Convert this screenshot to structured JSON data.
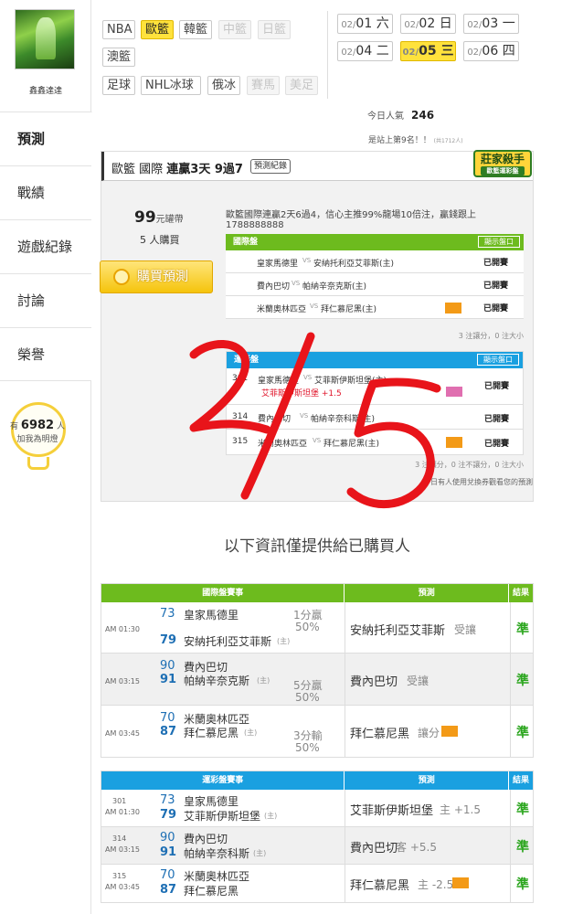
{
  "user": {
    "name": "鑫鑫達達"
  },
  "sidebar": {
    "items": [
      {
        "label": "預測",
        "active": true
      },
      {
        "label": "戰績"
      },
      {
        "label": "遊戲紀錄"
      },
      {
        "label": "討論"
      },
      {
        "label": "榮譽"
      }
    ],
    "fans_prefix": "有",
    "fans_count": "6982",
    "fans_suffix": "人",
    "fans_note": "加我為明燈"
  },
  "leagues": {
    "row1": [
      {
        "label": "NBA",
        "state": "normal"
      },
      {
        "label": "歐籃",
        "state": "selected"
      },
      {
        "label": "韓籃",
        "state": "normal"
      },
      {
        "label": "中籃",
        "state": "disabled"
      },
      {
        "label": "日籃",
        "state": "disabled"
      }
    ],
    "row2": [
      {
        "label": "澳籃",
        "state": "normal"
      }
    ],
    "row3": [
      {
        "label": "足球",
        "state": "normal"
      },
      {
        "label": "NHL冰球",
        "state": "normal"
      },
      {
        "label": "俄冰",
        "state": "normal"
      },
      {
        "label": "賽馬",
        "state": "disabled"
      },
      {
        "label": "美足",
        "state": "disabled"
      }
    ]
  },
  "dates": [
    {
      "mm": "02/",
      "dd": "01",
      "wd": "六",
      "selected": false
    },
    {
      "mm": "02/",
      "dd": "02",
      "wd": "日",
      "selected": false
    },
    {
      "mm": "02/",
      "dd": "03",
      "wd": "一",
      "selected": false
    },
    {
      "mm": "02/",
      "dd": "04",
      "wd": "二",
      "selected": false
    },
    {
      "mm": "02/",
      "dd": "05",
      "wd": "三",
      "selected": true
    },
    {
      "mm": "02/",
      "dd": "06",
      "wd": "四",
      "selected": false
    }
  ],
  "stats": {
    "popular_label": "今日人氣",
    "popular_value": "246",
    "rank_text": "是站上第9名！！",
    "rank_small": "(共1712人)"
  },
  "card": {
    "title_prefix": "歐籃 國際",
    "title_streak": "連贏3天 9過7",
    "record_btn": "預測紀錄",
    "badge_main": "莊家殺手",
    "badge_sub": "歐籃運彩盤",
    "price": "99",
    "price_unit": "元罐帶",
    "buyers": "5 人購買",
    "buy_btn": "購買預測",
    "note": "歐籃國際連贏2天6過4，信心主推99%龍場10倍注，贏錢跟上1788888888",
    "intl": {
      "header": "國際盤",
      "show_btn": "顯示盤口",
      "rows": [
        {
          "home": "皇家馬德里",
          "away": "安納托利亞艾菲斯(主)",
          "tag": false,
          "status": "已開賽"
        },
        {
          "home": "費內巴切",
          "away": "帕納辛奈克斯(主)",
          "tag": false,
          "status": "已開賽"
        },
        {
          "home": "米蘭奧林匹亞",
          "away": "拜仁慕尼黑(主)",
          "tag": true,
          "status": "已開賽"
        }
      ],
      "summary": "3 注讓分，0 注大小"
    },
    "lottery": {
      "header": "運彩盤",
      "show_btn": "顯示盤口",
      "rows": [
        {
          "no": "301",
          "home": "皇家馬德里",
          "away": "艾菲斯伊斯坦堡(主)",
          "pick": "艾菲斯伊斯坦堡 +1.5",
          "status": "已開賽"
        },
        {
          "no": "314",
          "home": "費內巴切",
          "away": "帕納辛奈科斯(主)",
          "pick": "",
          "status": "已開賽"
        },
        {
          "no": "315",
          "home": "米蘭奧林匹亞",
          "away": "拜仁慕尼黑(主)",
          "pick": "",
          "status": "已開賽"
        }
      ],
      "summary": "3 注讓分，0 注不讓分，0 注大小",
      "footer": "今日有人使用兌換券觀看您的預測"
    }
  },
  "info_note": "以下資訊僅提供給已購買人",
  "intl_results": {
    "headers": [
      "國際盤賽事",
      "預測",
      "結果"
    ],
    "rows": [
      {
        "time": "AM 01:30",
        "n1": "73",
        "t1": "皇家馬德里",
        "n2": "79",
        "t2": "安納托利亞艾菲斯",
        "t2tag": "(主)",
        "spread1": "1分贏",
        "spread2": "50%",
        "pick": "安納托利亞艾菲斯",
        "pick_note": "受讓",
        "result": "準"
      },
      {
        "time": "AM 03:15",
        "n1": "90",
        "t1": "費內巴切",
        "n2": "91",
        "t2": "帕納辛奈克斯",
        "t2tag": "(主)",
        "spread1": "5分贏",
        "spread2": "50%",
        "pick": "費內巴切",
        "pick_note": "受讓",
        "result": "準"
      },
      {
        "time": "AM 03:45",
        "n1": "70",
        "t1": "米蘭奧林匹亞",
        "n2": "87",
        "t2": "拜仁慕尼黑",
        "t2tag": "(主)",
        "spread1": "3分輸",
        "spread2": "50%",
        "pick": "拜仁慕尼黑",
        "pick_note": "讓分",
        "result": "準"
      }
    ]
  },
  "lottery_results": {
    "headers": [
      "運彩盤賽事",
      "預測",
      "結果"
    ],
    "rows": [
      {
        "no": "301",
        "time": "AM 01:30",
        "n1": "73",
        "t1": "皇家馬德里",
        "n2": "79",
        "t2": "艾菲斯伊斯坦堡",
        "t2tag": "(主)",
        "pick": "艾菲斯伊斯坦堡",
        "pick_note": "主 +1.5",
        "result": "準"
      },
      {
        "no": "314",
        "time": "AM 03:15",
        "n1": "90",
        "t1": "費內巴切",
        "n2": "91",
        "t2": "帕納辛奈科斯",
        "t2tag": "(主)",
        "pick": "費內巴切",
        "pick_note": "客 +5.5",
        "result": "準"
      },
      {
        "no": "315",
        "time": "AM 03:45",
        "n1": "70",
        "t1": "米蘭奧林匹亞",
        "n2": "87",
        "t2": "拜仁慕尼黑",
        "t2tag": "(主)",
        "pick": "拜仁慕尼黑",
        "pick_note": "主 -2.5",
        "result": "準"
      }
    ]
  },
  "colors": {
    "green": "#6dbb1e",
    "blue": "#1aa0e0",
    "yellow": "#ffe23c",
    "marker": "#e8141a"
  }
}
